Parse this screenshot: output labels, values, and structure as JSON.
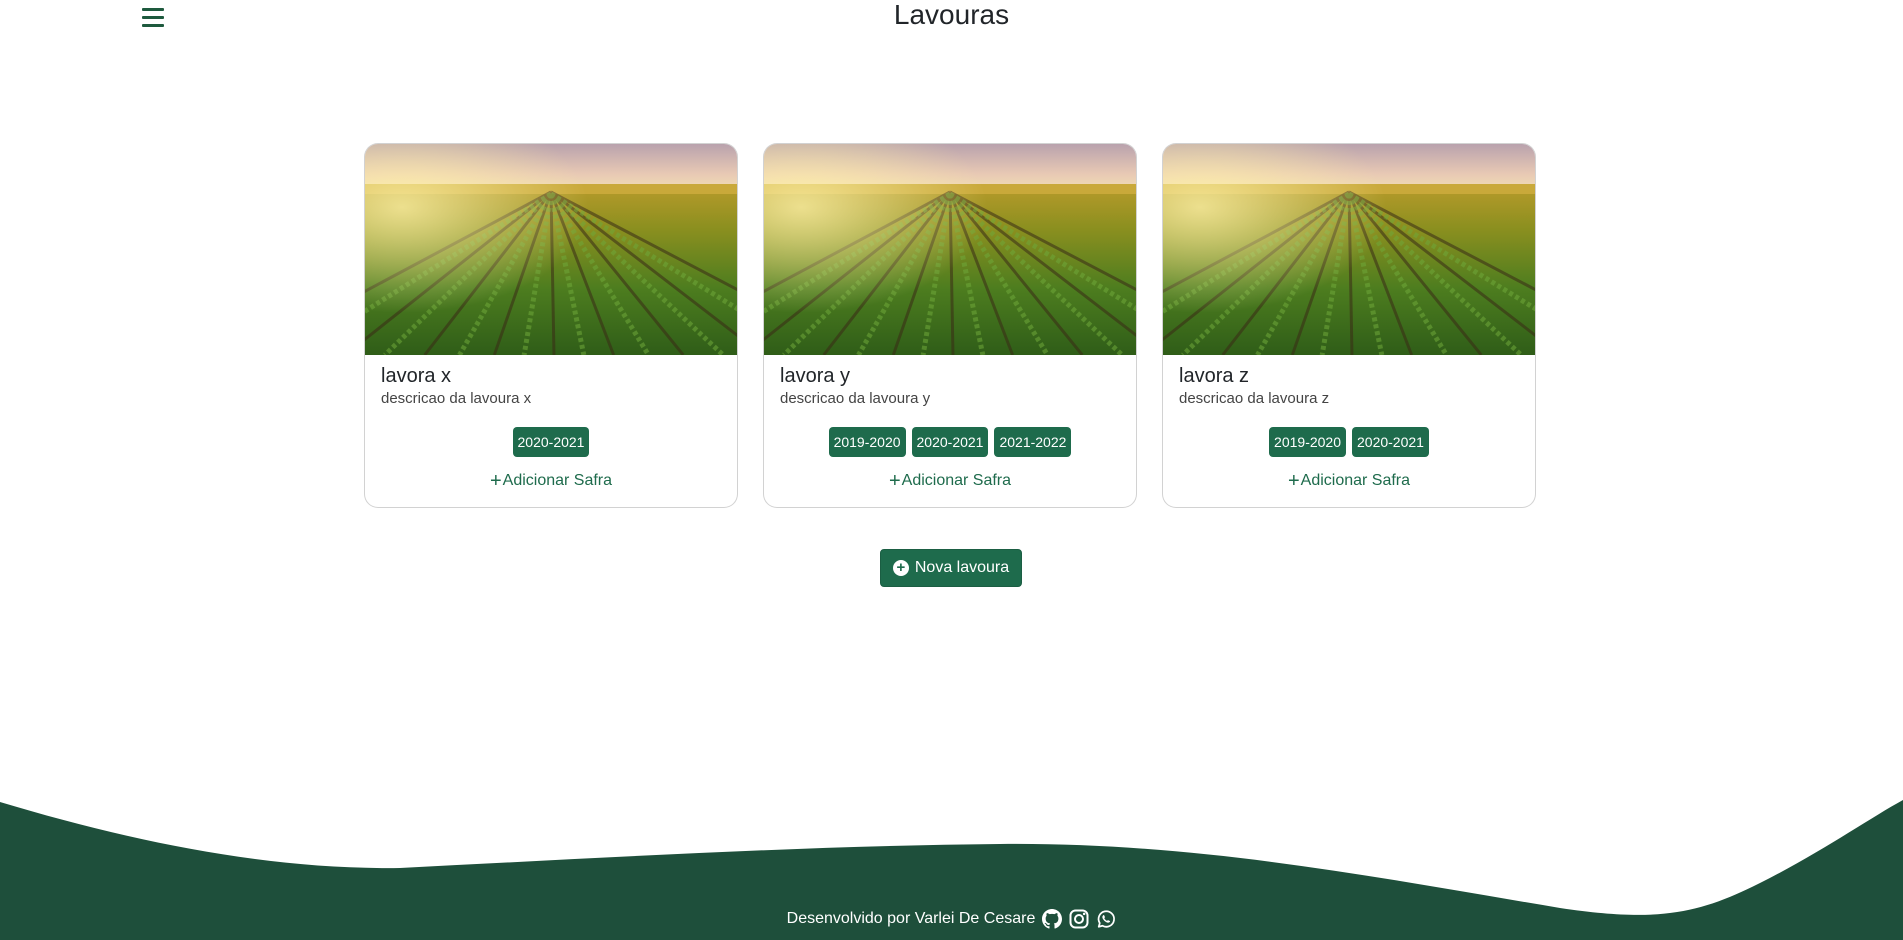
{
  "header": {
    "title": "Lavouras",
    "menu_icon": "hamburger-menu-icon"
  },
  "lavouras": [
    {
      "nome": "lavora x",
      "descricao": "descricao da lavoura x",
      "safras": [
        "2020-2021"
      ],
      "adicionar": "Adicionar Safra"
    },
    {
      "nome": "lavora y",
      "descricao": "descricao da lavoura y",
      "safras": [
        "2019-2020",
        "2020-2021",
        "2021-2022"
      ],
      "adicionar": "Adicionar Safra"
    },
    {
      "nome": "lavora z",
      "descricao": "descricao da lavoura z",
      "safras": [
        "2019-2020",
        "2020-2021"
      ],
      "adicionar": "Adicionar Safra"
    }
  ],
  "nova_lavoura_label": "Nova lavoura",
  "footer": {
    "credit": "Desenvolvido por Varlei De Cesare",
    "icons": [
      "github-icon",
      "instagram-icon",
      "whatsapp-icon"
    ]
  },
  "colors": {
    "primary": "#1e6b4c",
    "footer": "#1e4f3b"
  }
}
